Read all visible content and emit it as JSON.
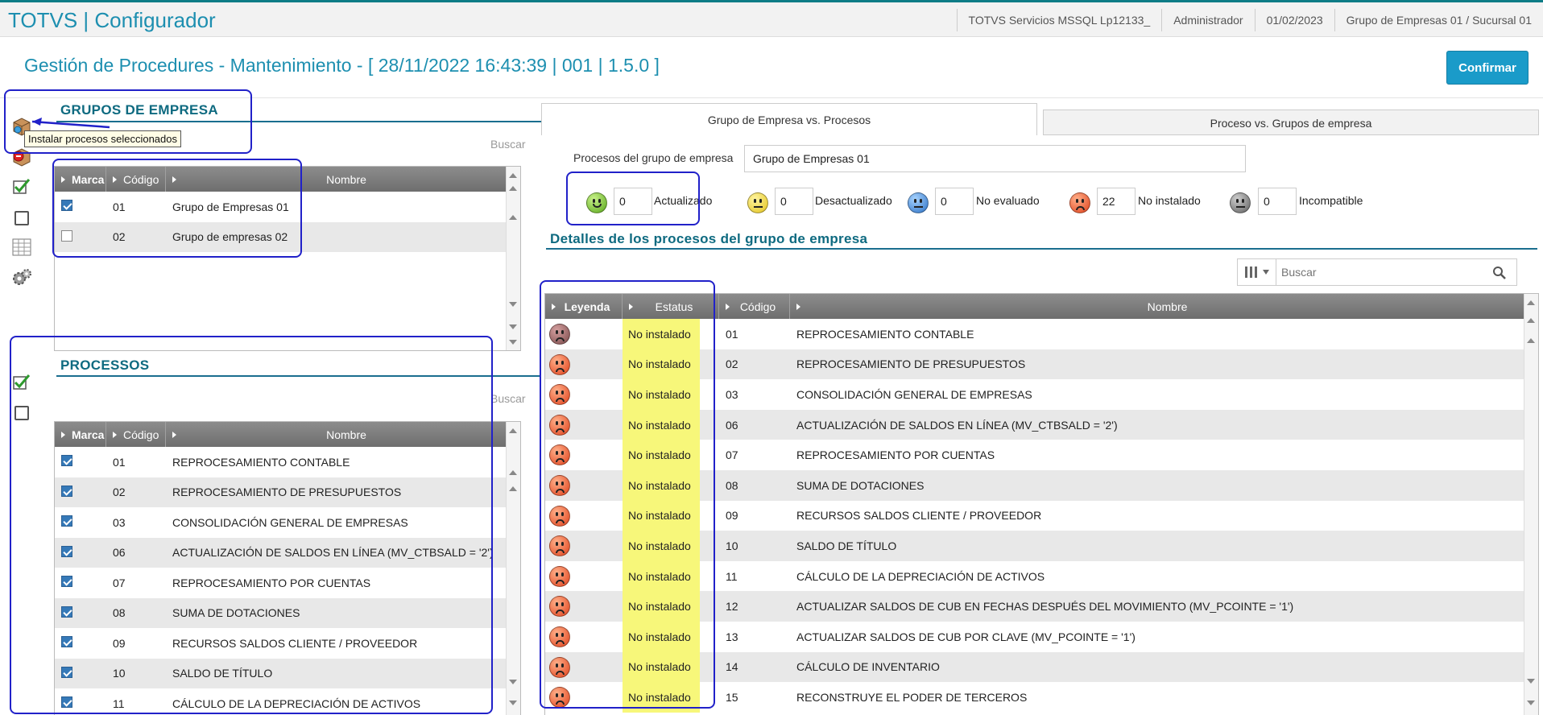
{
  "app": {
    "title": "TOTVS | Configurador",
    "environment": "TOTVS Servicios MSSQL Lp12133_",
    "user": "Administrador",
    "date": "01/02/2023",
    "company": "Grupo de Empresas 01 / Sucursal 01"
  },
  "page": {
    "title": "Gestión de Procedures - Mantenimiento - [ 28/11/2022 16:43:39 | 001 | 1.5.0 ]",
    "confirm_label": "Confirmar"
  },
  "tooltip": "Instalar procesos seleccionados",
  "groups": {
    "title": "GRUPOS DE EMPRESA",
    "search_label": "Buscar",
    "headers": [
      "Marca",
      "Código",
      "Nombre"
    ],
    "rows": [
      {
        "checked": true,
        "code": "01",
        "name": "Grupo de Empresas 01"
      },
      {
        "checked": false,
        "code": "02",
        "name": "Grupo de empresas 02"
      }
    ]
  },
  "processes": {
    "title": "PROCESSOS",
    "search_label": "Buscar",
    "headers": [
      "Marca",
      "Código",
      "Nombre"
    ],
    "rows": [
      {
        "checked": true,
        "code": "01",
        "name": "REPROCESAMIENTO CONTABLE"
      },
      {
        "checked": true,
        "code": "02",
        "name": "REPROCESAMIENTO DE PRESUPUESTOS"
      },
      {
        "checked": true,
        "code": "03",
        "name": "CONSOLIDACIÓN GENERAL DE EMPRESAS"
      },
      {
        "checked": true,
        "code": "06",
        "name": "ACTUALIZACIÓN DE SALDOS EN LÍNEA (MV_CTBSALD = '2')"
      },
      {
        "checked": true,
        "code": "07",
        "name": "REPROCESAMIENTO POR CUENTAS"
      },
      {
        "checked": true,
        "code": "08",
        "name": "SUMA DE DOTACIONES"
      },
      {
        "checked": true,
        "code": "09",
        "name": "RECURSOS SALDOS CLIENTE / PROVEEDOR"
      },
      {
        "checked": true,
        "code": "10",
        "name": "SALDO DE TÍTULO"
      },
      {
        "checked": true,
        "code": "11",
        "name": "CÁLCULO DE LA DEPRECIACIÓN DE ACTIVOS"
      }
    ]
  },
  "tabs": {
    "active": "Grupo de Empresa vs. Procesos",
    "inactive": "Proceso vs. Grupos de empresa"
  },
  "group_process": {
    "label": "Procesos del grupo de empresa",
    "value": "Grupo de Empresas 01",
    "statuses": [
      {
        "count": "0",
        "label": "Actualizado",
        "color": "#58a61a"
      },
      {
        "count": "0",
        "label": "Desactualizado",
        "color": "#e2c21c"
      },
      {
        "count": "0",
        "label": "No evaluado",
        "color": "#2a6fc4"
      },
      {
        "count": "22",
        "label": "No instalado",
        "color": "#e0401a"
      },
      {
        "count": "0",
        "label": "Incompatible",
        "color": "#5e5e5e"
      }
    ]
  },
  "details": {
    "title": "Detalles de los procesos del grupo de empresa",
    "search_placeholder": "Buscar",
    "headers": [
      "Leyenda",
      "Estatus",
      "Código",
      "Nombre"
    ],
    "rows": [
      {
        "status": "No instalado",
        "code": "01",
        "name": "REPROCESAMIENTO CONTABLE"
      },
      {
        "status": "No instalado",
        "code": "02",
        "name": "REPROCESAMIENTO DE PRESUPUESTOS"
      },
      {
        "status": "No instalado",
        "code": "03",
        "name": "CONSOLIDACIÓN GENERAL DE EMPRESAS"
      },
      {
        "status": "No instalado",
        "code": "06",
        "name": "ACTUALIZACIÓN DE SALDOS EN LÍNEA (MV_CTBSALD = '2')"
      },
      {
        "status": "No instalado",
        "code": "07",
        "name": "REPROCESAMIENTO POR CUENTAS"
      },
      {
        "status": "No instalado",
        "code": "08",
        "name": "SUMA DE DOTACIONES"
      },
      {
        "status": "No instalado",
        "code": "09",
        "name": "RECURSOS SALDOS CLIENTE / PROVEEDOR"
      },
      {
        "status": "No instalado",
        "code": "10",
        "name": "SALDO DE TÍTULO"
      },
      {
        "status": "No instalado",
        "code": "11",
        "name": "CÁLCULO DE LA DEPRECIACIÓN DE ACTIVOS"
      },
      {
        "status": "No instalado",
        "code": "12",
        "name": "ACTUALIZAR SALDOS DE CUB EN FECHAS DESPUÉS DEL MOVIMIENTO (MV_PCOINTE = '1')"
      },
      {
        "status": "No instalado",
        "code": "13",
        "name": "ACTUALIZAR SALDOS DE CUB POR CLAVE (MV_PCOINTE = '1')"
      },
      {
        "status": "No instalado",
        "code": "14",
        "name": "CÁLCULO DE INVENTARIO"
      },
      {
        "status": "No instalado",
        "code": "15",
        "name": "RECONSTRUYE EL PODER DE TERCEROS"
      }
    ]
  }
}
